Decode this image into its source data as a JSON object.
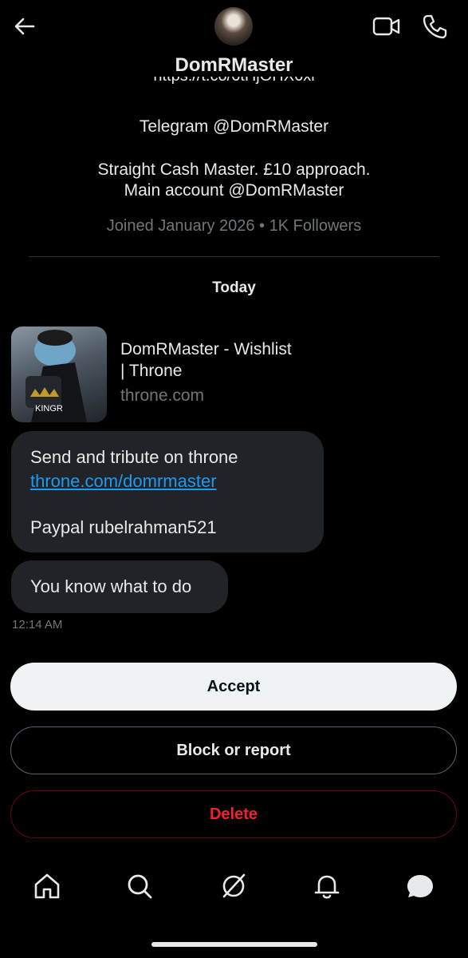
{
  "header": {
    "name": "DomRMaster",
    "back_icon": "arrow-left-icon",
    "video_icon": "video-camera-icon",
    "phone_icon": "phone-icon"
  },
  "profile": {
    "link_partial": "https://t.co/6tHjOHX6xl",
    "bio_line1": "Telegram @DomRMaster",
    "bio_line2a": "Straight Cash Master. £10 approach.",
    "bio_line2b": "Main account @DomRMaster",
    "meta": "Joined January 2026 • 1K Followers"
  },
  "conversation": {
    "date_separator": "Today",
    "link_card": {
      "title_line1": "DomRMaster - Wishlist",
      "title_line2": "| Throne",
      "domain": "throne.com",
      "image_caption": "KINGR"
    },
    "messages": [
      {
        "line1": "Send and tribute on throne",
        "link": "throne.com/domrmaster",
        "line3": "Paypal rubelrahman521"
      },
      {
        "text": "You know what to do"
      }
    ],
    "timestamp": "12:14 AM"
  },
  "actions": {
    "accept": "Accept",
    "block_report": "Block or report",
    "delete": "Delete"
  },
  "bottom_nav": [
    "home-icon",
    "search-icon",
    "grok-icon",
    "notifications-icon",
    "messages-icon"
  ],
  "colors": {
    "accent": "#1d9bf0",
    "danger": "#f4212e",
    "muted": "#71767b",
    "bubble": "#202327"
  }
}
